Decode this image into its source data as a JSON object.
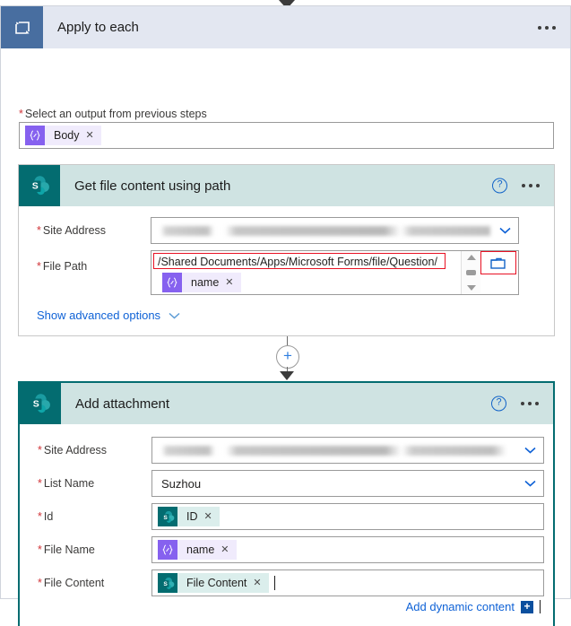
{
  "colors": {
    "scope_header_bg": "#e3e7f1",
    "scope_icon_bg": "#486ea0",
    "sharepoint_teal": "#036c70",
    "card_header_teal": "#cfe3e2",
    "expression_purple": "#8661ef",
    "link_blue": "#0f62d6",
    "required_red": "#d13438",
    "annotation_red": "#e81123"
  },
  "scope": {
    "title": "Apply to each",
    "icon": "loop-icon",
    "menu_icon": "ellipsis-icon",
    "output_field": {
      "label": "Select an output from previous steps",
      "required": true,
      "token": {
        "text": "Body",
        "icon": "expression-icon",
        "remove_icon": "close-icon",
        "type": "expression"
      }
    }
  },
  "cards": [
    {
      "title": "Get file content using path",
      "icon": "sharepoint-icon",
      "help_icon": "help-icon",
      "menu_icon": "ellipsis-icon",
      "selected": false,
      "fields": {
        "site_address": {
          "label": "Site Address",
          "required": true,
          "value": "",
          "redacted": true,
          "chevron_icon": "chevron-down-icon"
        },
        "file_path": {
          "label": "File Path",
          "required": true,
          "value": "/Shared Documents/Apps/Microsoft Forms/file/Question/",
          "annotated": true,
          "token": {
            "text": "name",
            "icon": "expression-icon",
            "remove_icon": "close-icon",
            "type": "expression"
          },
          "scroll_up_icon": "scroll-up-arrow-icon",
          "scroll_thumb_icon": "scrollbar-thumb",
          "scroll_down_icon": "scroll-down-arrow-icon",
          "picker_icon": "folder-picker-icon",
          "picker_annotated": true
        }
      },
      "advanced_link": {
        "label": "Show advanced options",
        "chevron_icon": "chevron-down-icon"
      }
    },
    {
      "title": "Add attachment",
      "icon": "sharepoint-icon",
      "help_icon": "help-icon",
      "menu_icon": "ellipsis-icon",
      "selected": true,
      "fields": {
        "site_address": {
          "label": "Site Address",
          "required": true,
          "value": "",
          "redacted": true,
          "chevron_icon": "chevron-down-icon"
        },
        "list_name": {
          "label": "List Name",
          "required": true,
          "value": "Suzhou",
          "chevron_icon": "chevron-down-icon"
        },
        "id": {
          "label": "Id",
          "required": true,
          "token": {
            "text": "ID",
            "icon": "sharepoint-icon",
            "remove_icon": "close-icon",
            "type": "sharepoint"
          }
        },
        "file_name": {
          "label": "File Name",
          "required": true,
          "token": {
            "text": "name",
            "icon": "expression-icon",
            "remove_icon": "close-icon",
            "type": "expression"
          }
        },
        "file_content": {
          "label": "File Content",
          "required": true,
          "token": {
            "text": "File Content",
            "icon": "sharepoint-icon",
            "remove_icon": "close-icon",
            "type": "sharepoint"
          },
          "has_caret": true
        }
      },
      "dynamic_content_link": {
        "label": "Add dynamic content",
        "plus_label": "+"
      }
    }
  ],
  "connector": {
    "add_step_label": "+",
    "arrow_icon": "arrow-down-icon"
  }
}
